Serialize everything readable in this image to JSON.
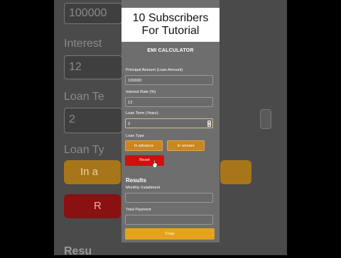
{
  "video_title": {
    "line1": "10 Subscribers",
    "line2": "For Tutorial"
  },
  "app": {
    "header": "EMI CALCULATOR"
  },
  "form": {
    "principal_label": "Principal Amount (Loan Amount)",
    "principal_value": "100000",
    "rate_label": "Interest Rate (%)",
    "rate_value": "12",
    "term_label": "Loan Term (Years)",
    "term_value": "2",
    "type_label": "Loan Type",
    "in_advance": "In advance",
    "in_arrears": "In arrears",
    "reset": "Reset"
  },
  "results": {
    "heading": "Results",
    "monthly_label": "Monthly Installment",
    "monthly_value": "",
    "total_label": "Total Payment",
    "total_value": "",
    "copy": "Copy"
  },
  "background": {
    "principal_value": "100000",
    "interest_label": "Interest",
    "rate_value": "12",
    "term_label": "Loan Te",
    "term_value": "2",
    "type_label": "Loan Ty",
    "advance_partial": "In a",
    "reset_partial": "R",
    "results_partial": "Resu"
  },
  "colors": {
    "orange": "#c88720",
    "red": "#d10f0f",
    "copy": "#e6a11d",
    "panel": "#6e6e6e"
  }
}
